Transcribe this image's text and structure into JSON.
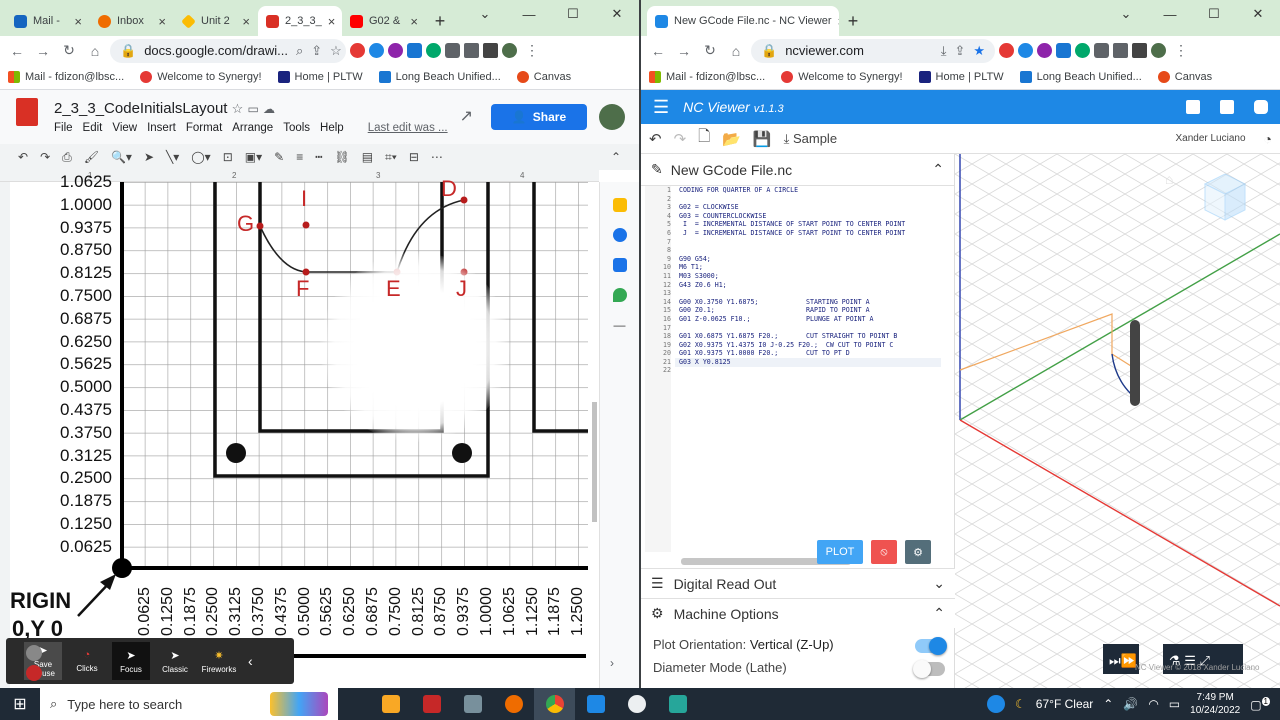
{
  "left": {
    "tabs": [
      {
        "label": "Mail -",
        "color": "#1565c0"
      },
      {
        "label": "Inbox",
        "color": "#ef6c00"
      },
      {
        "label": "Unit 2",
        "color": "#fbbc04"
      },
      {
        "label": "2_3_3_",
        "color": "#d93025"
      },
      {
        "label": "G02 &",
        "color": "#ff0000"
      }
    ],
    "url": "docs.google.com/drawi...",
    "bookmarks": [
      "Mail - fdizon@lbsc...",
      "Welcome to Synergy!",
      "Home | PLTW",
      "Long Beach Unified...",
      "Canvas"
    ],
    "doc_title": "2_3_3_CodeInitialsLayout",
    "menus": [
      "File",
      "Edit",
      "View",
      "Insert",
      "Format",
      "Arrange",
      "Tools",
      "Help"
    ],
    "last_edit": "Last edit was ...",
    "share_label": "Share",
    "ruler": [
      "1",
      "2",
      "3",
      "4"
    ],
    "y_labels": [
      "1.0625",
      "1.0000",
      "0.9375",
      "0.8750",
      "0.8125",
      "0.7500",
      "0.6875",
      "0.6250",
      "0.5625",
      "0.5000",
      "0.4375",
      "0.3750",
      "0.3125",
      "0.2500",
      "0.1875",
      "0.1250",
      "0.0625"
    ],
    "x_labels": [
      "0.0625",
      "0.1250",
      "0.1875",
      "0.2500",
      "0.3125",
      "0.3750",
      "0.4375",
      "0.5000",
      "0.5625",
      "0.6250",
      "0.6875",
      "0.7500",
      "0.8125",
      "0.8750",
      "0.9375",
      "1.0000",
      "1.0625",
      "1.1250",
      "1.1875",
      "1.2500"
    ],
    "points": {
      "G": "G",
      "I": "I",
      "D": "D",
      "F": "F",
      "E": "E",
      "J": "J"
    },
    "origin_label": "RIGIN",
    "origin_coords": "0,Y 0",
    "pres_tools": [
      "Save Mouse",
      "Clicks",
      "Focus",
      "Classic",
      "Fireworks"
    ]
  },
  "right": {
    "tab_title": "New GCode File.nc - NC Viewer",
    "url": "ncviewer.com",
    "bookmarks": [
      "Mail - fdizon@lbsc...",
      "Welcome to Synergy!",
      "Home | PLTW",
      "Long Beach Unified...",
      "Canvas"
    ],
    "app_name": "NC Viewer",
    "version": "v1.1.3",
    "sample_label": "Sample",
    "user_name": "Xander Luciano",
    "file_name": "New GCode File.nc",
    "code_lines": [
      "CODING FOR QUARTER OF A CIRCLE",
      "",
      "G02 = CLOCKWISE",
      "G03 = COUNTERCLOCKWISE",
      " I  = INCREMENTAL DISTANCE OF START POINT TO CENTER POINT",
      " J  = INCREMENTAL DISTANCE OF START POINT TO CENTER POINT",
      "",
      "",
      "G90 G54;",
      "M6 T1;",
      "M03 S3000;",
      "G43 Z0.6 H1;",
      "",
      "G00 X0.3750 Y1.6875;            STARTING POINT A",
      "G00 Z0.1;                       RAPID TO POINT A",
      "G01 Z-0.0625 F10.;              PLUNGE AT POINT A",
      "",
      "G01 X0.6875 Y1.6875 F20.;       CUT STRAIGHT TO POINT B",
      "G02 X0.9375 Y1.4375 I0 J-0.25 F20.;  CW CUT TO POINT C",
      "G01 X0.9375 Y1.0000 F20.;       CUT TO PT D",
      "G03 X Y0.8125",
      ""
    ],
    "plot_label": "PLOT",
    "dro_label": "Digital Read Out",
    "machine_options_label": "Machine Options",
    "plot_orientation_label": "Plot Orientation:",
    "plot_orientation_value": "Vertical (Z-Up)",
    "plot_orientation_on": true,
    "diameter_mode_label": "Diameter Mode (Lathe)",
    "diameter_mode_on": false,
    "watermark": "NC Viewer © 2018 Xander Luciano",
    "accent": "#1e88e5"
  },
  "taskbar": {
    "search_placeholder": "Type here to search",
    "weather": "67°F  Clear",
    "time": "7:49 PM",
    "date": "10/24/2022",
    "notifications": "1"
  }
}
